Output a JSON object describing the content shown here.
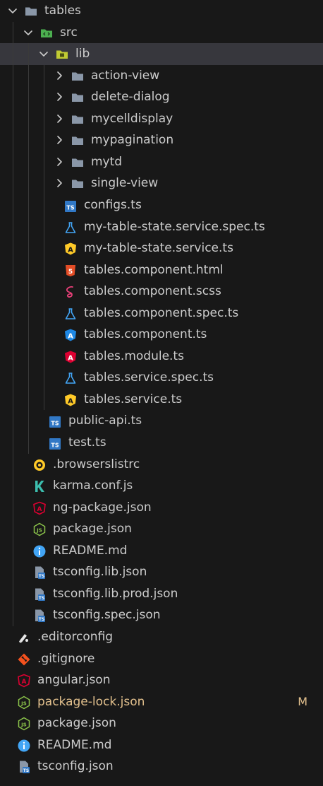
{
  "explorer": {
    "items": [
      {
        "label": "tables",
        "kind": "folder",
        "icon": "folder-icon",
        "depth": 0,
        "expanded": true
      },
      {
        "label": "src",
        "kind": "folder",
        "icon": "folder-src-icon",
        "depth": 1,
        "expanded": true
      },
      {
        "label": "lib",
        "kind": "folder",
        "icon": "folder-lib-icon",
        "depth": 2,
        "expanded": true,
        "selected": true
      },
      {
        "label": "action-view",
        "kind": "folder",
        "icon": "folder-icon",
        "depth": 3,
        "expanded": false
      },
      {
        "label": "delete-dialog",
        "kind": "folder",
        "icon": "folder-icon",
        "depth": 3,
        "expanded": false
      },
      {
        "label": "mycelldisplay",
        "kind": "folder",
        "icon": "folder-icon",
        "depth": 3,
        "expanded": false
      },
      {
        "label": "mypagination",
        "kind": "folder",
        "icon": "folder-icon",
        "depth": 3,
        "expanded": false
      },
      {
        "label": "mytd",
        "kind": "folder",
        "icon": "folder-icon",
        "depth": 3,
        "expanded": false
      },
      {
        "label": "single-view",
        "kind": "folder",
        "icon": "folder-icon",
        "depth": 3,
        "expanded": false
      },
      {
        "label": "configs.ts",
        "kind": "file",
        "icon": "typescript-icon",
        "depth": 3
      },
      {
        "label": "my-table-state.service.spec.ts",
        "kind": "file",
        "icon": "test-flask-icon",
        "depth": 3
      },
      {
        "label": "my-table-state.service.ts",
        "kind": "file",
        "icon": "angular-service-icon",
        "depth": 3
      },
      {
        "label": "tables.component.html",
        "kind": "file",
        "icon": "html5-icon",
        "depth": 3
      },
      {
        "label": "tables.component.scss",
        "kind": "file",
        "icon": "sass-icon",
        "depth": 3
      },
      {
        "label": "tables.component.spec.ts",
        "kind": "file",
        "icon": "test-flask-icon",
        "depth": 3
      },
      {
        "label": "tables.component.ts",
        "kind": "file",
        "icon": "angular-component-icon",
        "depth": 3
      },
      {
        "label": "tables.module.ts",
        "kind": "file",
        "icon": "angular-module-icon",
        "depth": 3
      },
      {
        "label": "tables.service.spec.ts",
        "kind": "file",
        "icon": "test-flask-icon",
        "depth": 3
      },
      {
        "label": "tables.service.ts",
        "kind": "file",
        "icon": "angular-service-icon",
        "depth": 3
      },
      {
        "label": "public-api.ts",
        "kind": "file",
        "icon": "typescript-icon",
        "depth": 2
      },
      {
        "label": "test.ts",
        "kind": "file",
        "icon": "typescript-icon",
        "depth": 2
      },
      {
        "label": ".browserslistrc",
        "kind": "file",
        "icon": "browserslist-icon",
        "depth": 1
      },
      {
        "label": "karma.conf.js",
        "kind": "file",
        "icon": "karma-icon",
        "depth": 1
      },
      {
        "label": "ng-package.json",
        "kind": "file",
        "icon": "angular-icon",
        "depth": 1
      },
      {
        "label": "package.json",
        "kind": "file",
        "icon": "nodejs-icon",
        "depth": 1
      },
      {
        "label": "README.md",
        "kind": "file",
        "icon": "info-icon",
        "depth": 1
      },
      {
        "label": "tsconfig.lib.json",
        "kind": "file",
        "icon": "tsconfig-icon",
        "depth": 1
      },
      {
        "label": "tsconfig.lib.prod.json",
        "kind": "file",
        "icon": "tsconfig-icon",
        "depth": 1
      },
      {
        "label": "tsconfig.spec.json",
        "kind": "file",
        "icon": "tsconfig-icon",
        "depth": 1
      },
      {
        "label": ".editorconfig",
        "kind": "file",
        "icon": "editorconfig-icon",
        "depth": 0
      },
      {
        "label": ".gitignore",
        "kind": "file",
        "icon": "git-icon",
        "depth": 0
      },
      {
        "label": "angular.json",
        "kind": "file",
        "icon": "angular-icon",
        "depth": 0
      },
      {
        "label": "package-lock.json",
        "kind": "file",
        "icon": "nodejs-icon",
        "depth": 0,
        "modified": true,
        "badge": "M"
      },
      {
        "label": "package.json",
        "kind": "file",
        "icon": "nodejs-icon",
        "depth": 0
      },
      {
        "label": "README.md",
        "kind": "file",
        "icon": "info-icon",
        "depth": 0
      },
      {
        "label": "tsconfig.json",
        "kind": "file",
        "icon": "tsconfig-icon",
        "depth": 0
      }
    ]
  },
  "colors": {
    "background": "#181818",
    "text": "#cccccc",
    "modified_text": "#e2c08d",
    "selected_row": "#37373d",
    "folder": "#8a97a8",
    "typescript": "#3178c6",
    "angular": "#dd0031",
    "angular_component": "#1e88e5",
    "angular_service": "#ffca28",
    "test": "#42a5f5",
    "html": "#e44d26",
    "sass": "#ec407a",
    "nodejs": "#8bc34a",
    "karma": "#3cbeae",
    "git": "#f4511e",
    "info": "#42a5f5",
    "folder_src": "#4caf50",
    "folder_lib": "#c0ca33",
    "browserslist": "#ffca28"
  }
}
